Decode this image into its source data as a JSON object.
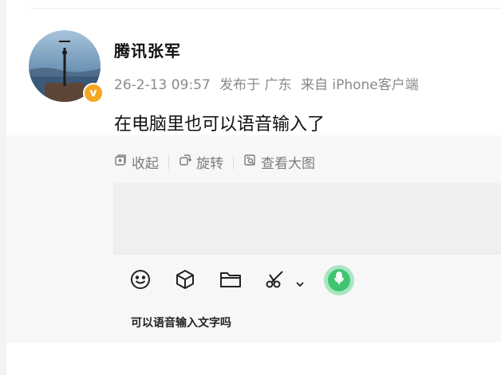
{
  "post": {
    "username": "腾讯张军",
    "time": "26-2-13 09:57",
    "published_at": "发布于 广东",
    "source": "来自 iPhone客户端",
    "text": "在电脑里也可以语音输入了"
  },
  "actions": [
    {
      "label": "收起",
      "icon": "collapse-icon"
    },
    {
      "label": "旋转",
      "icon": "rotate-icon"
    },
    {
      "label": "查看大图",
      "icon": "view-large-image-icon"
    }
  ],
  "composer": {
    "caption": "可以语音输入文字吗",
    "tools": [
      "emoji-icon",
      "cube-icon",
      "folder-icon",
      "scissors-icon",
      "chevron-down-icon",
      "microphone-icon"
    ]
  },
  "colors": {
    "verified_badge": "#f5a623",
    "mic_green": "#3fc46f",
    "mic_halo": "#a8e6c1"
  },
  "badge": {
    "verified_label": "v"
  }
}
